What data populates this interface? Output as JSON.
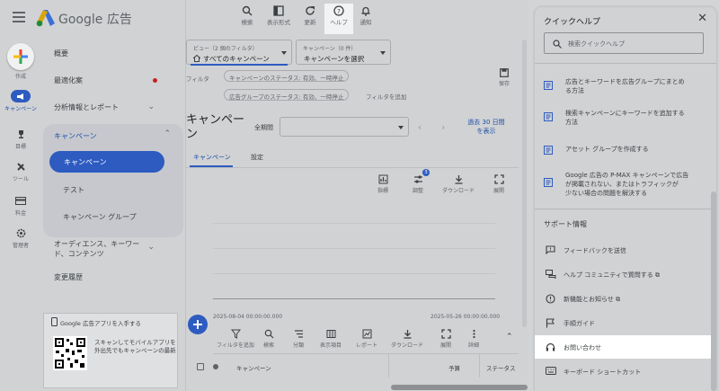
{
  "app": {
    "title": "Google 広告"
  },
  "toolbar": [
    {
      "label": "検索",
      "icon": "search-icon"
    },
    {
      "label": "表示形式",
      "icon": "appearance-icon"
    },
    {
      "label": "更新",
      "icon": "refresh-icon"
    },
    {
      "label": "ヘルプ",
      "icon": "help-icon"
    },
    {
      "label": "通知",
      "icon": "bell-icon"
    }
  ],
  "rail": {
    "create": "作成",
    "items": [
      {
        "label": "キャンペーン",
        "icon": "campaign-icon"
      },
      {
        "label": "目標",
        "icon": "trophy-icon"
      },
      {
        "label": "ツール",
        "icon": "tools-icon"
      },
      {
        "label": "料金",
        "icon": "billing-icon"
      },
      {
        "label": "管理者",
        "icon": "admin-icon"
      }
    ]
  },
  "nav": {
    "overview": "概要",
    "recommendations": "最適化案",
    "insights": "分析情報とレポート",
    "campaigns_group": "キャンペーン",
    "campaigns": "キャンペーン",
    "experiments": "テスト",
    "campaign_groups": "キャンペーン グループ",
    "audiences_l1": "オーディエンス、キーワー",
    "audiences_l2": "ド、コンテンツ",
    "change_history": "変更履歴",
    "app_card": {
      "title": "Google 広告アプリを入手する",
      "text_l1": "スキャンしてモバイルアプリを",
      "text_l2": "外出先でもキャンペーンの最新"
    }
  },
  "main": {
    "view_label": "ビュー（2 個のフィルタ）",
    "view_value": "すべてのキャンペーン",
    "campaign_label": "キャンペーン（0 件）",
    "campaign_value": "キャンペーンを選択",
    "filter_label": "フィルタ",
    "chip1": "キャンペーンのステータス: 有効、一時停止",
    "chip2": "広告グループのステータス: 有効、一時停止",
    "add_filter": "フィルタを追加",
    "save": "保存",
    "title_l1": "キャンペー",
    "title_l2": "ン",
    "period_label": "全期間",
    "date_link_l1": "過去 30 日間",
    "date_link_l2": "を表示",
    "tabs": [
      "キャンペーン",
      "設定"
    ],
    "chart_tools": [
      {
        "label": "指標",
        "icon": "metrics-icon"
      },
      {
        "label": "調整",
        "icon": "adjust-icon"
      },
      {
        "label": "ダウンロード",
        "icon": "download-icon"
      },
      {
        "label": "展開",
        "icon": "expand-icon"
      }
    ],
    "adjust_badge": "3",
    "date_start": "2025-08-04 00:00:00.000",
    "date_end": "2025-05-26 00:00:00.000",
    "table_tools": [
      {
        "label": "フィルタを追加",
        "icon": "filter-icon"
      },
      {
        "label": "検索",
        "icon": "search-icon"
      },
      {
        "label": "分類",
        "icon": "segment-icon"
      },
      {
        "label": "表示項目",
        "icon": "columns-icon"
      },
      {
        "label": "レポート",
        "icon": "reports-icon"
      },
      {
        "label": "ダウンロード",
        "icon": "download-icon"
      },
      {
        "label": "展開",
        "icon": "expand-icon"
      },
      {
        "label": "詳細",
        "icon": "more-icon"
      }
    ],
    "columns": [
      "キャンペーン",
      "予算",
      "ステータス"
    ]
  },
  "help": {
    "title": "クイックヘルプ",
    "search_placeholder": "検索クイックヘルプ",
    "articles": [
      {
        "l1": "広告とキーワードを広告グループにまとめ",
        "l2": "る方法",
        "l3": ""
      },
      {
        "l1": "検索キャンペーンにキーワードを追加する",
        "l2": "方法",
        "l3": ""
      },
      {
        "l1": "アセット グループを作成する",
        "l2": "",
        "l3": ""
      },
      {
        "l1": "Google 広告の P-MAX キャンペーンで広告",
        "l2": "が掲載されない、またはトラフィックが",
        "l3": "少ない場合の問題を解決する"
      }
    ],
    "support_title": "サポート情報",
    "support": [
      {
        "label": "フィードバックを送信",
        "icon": "feedback-icon"
      },
      {
        "label": "ヘルプ コミュニティで質問する",
        "icon": "community-icon"
      },
      {
        "label": "新機能とお知らせ",
        "icon": "news-icon"
      },
      {
        "label": "手順ガイド",
        "icon": "flag-icon"
      },
      {
        "label": "お問い合わせ",
        "icon": "headset-icon"
      },
      {
        "label": "キーボード ショートカット",
        "icon": "keyboard-icon"
      }
    ]
  }
}
